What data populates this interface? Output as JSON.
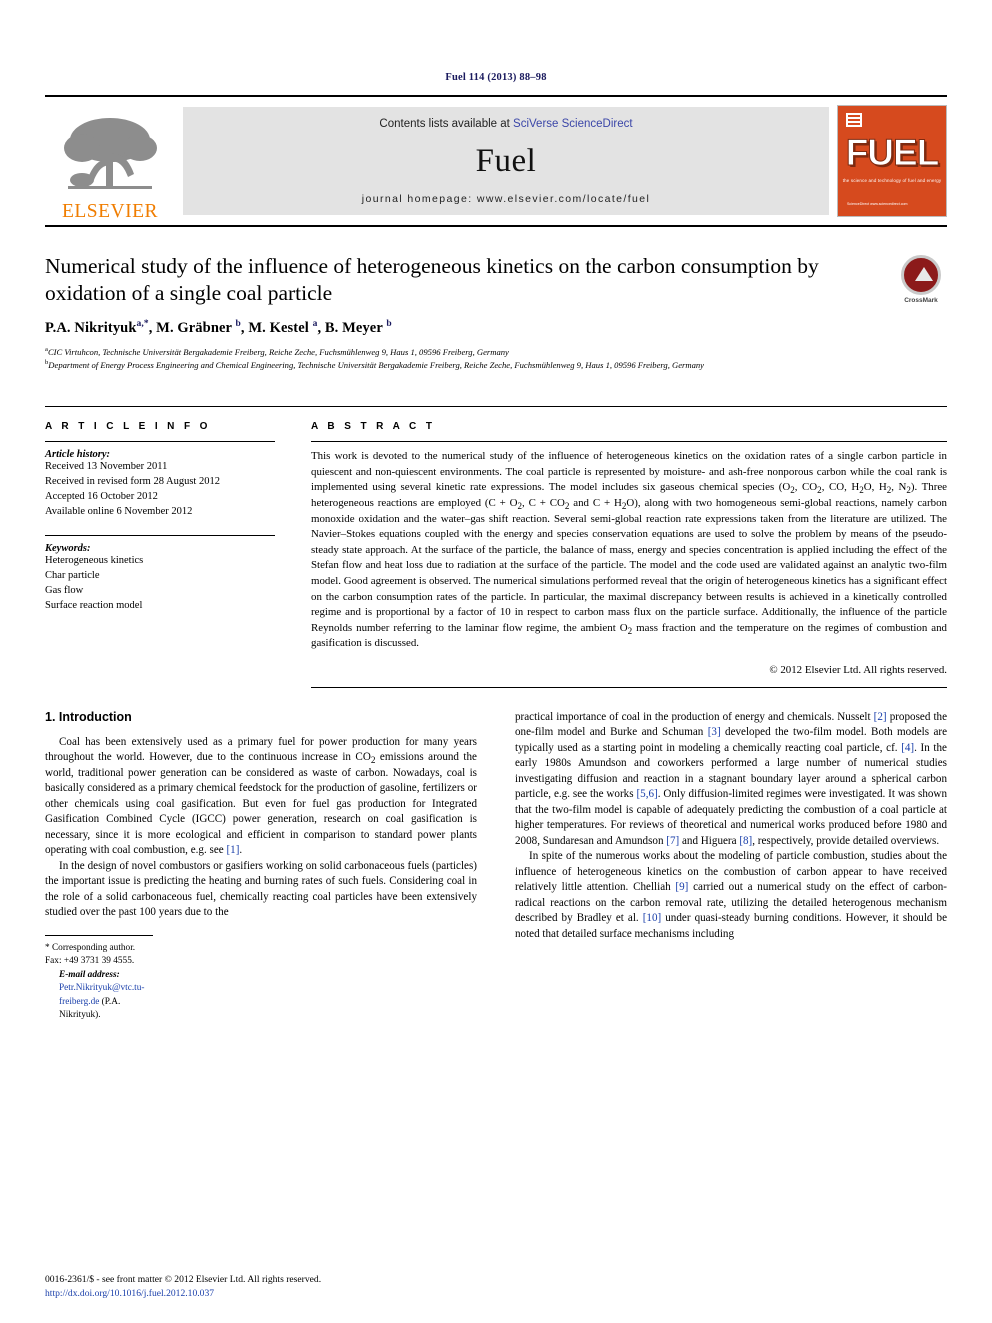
{
  "running_head": "Fuel 114 (2013) 88–98",
  "masthead": {
    "publisher_name": "ELSEVIER",
    "contents_prefix": "Contents lists available at ",
    "contents_link": "SciVerse ScienceDirect",
    "journal_title": "Fuel",
    "homepage": "journal homepage: www.elsevier.com/locate/fuel",
    "cover": {
      "title": "FUEL",
      "subtitle": "the science and technology of fuel and energy",
      "footer": "ScienceDirect\nwww.sciencedirect.com"
    }
  },
  "article": {
    "title": "Numerical study of the influence of heterogeneous kinetics on the carbon consumption by oxidation of a single coal particle",
    "authors_html": "P.A. Nikrityuk<sup>a,*</sup>, M. Gräbner <sup>b</sup>, M. Kestel <sup>a</sup>, B. Meyer <sup>b</sup>",
    "affiliations": [
      "<sup>a</sup>CIC Virtuhcon, Technische Universität Bergakademie Freiberg, Reiche Zeche, Fuchsmühlenweg 9, Haus 1, 09596 Freiberg, Germany",
      "<sup>b</sup>Department of Energy Process Engineering and Chemical Engineering, Technische Universität Bergakademie Freiberg, Reiche Zeche, Fuchsmühlenweg 9, Haus 1, 09596 Freiberg, Germany"
    ],
    "crossmark_label": "CrossMark"
  },
  "info": {
    "heading": "A R T I C L E    I N F O",
    "history_label": "Article history:",
    "history": [
      "Received 13 November 2011",
      "Received in revised form 28 August 2012",
      "Accepted 16 October 2012",
      "Available online 6 November 2012"
    ],
    "keywords_label": "Keywords:",
    "keywords": [
      "Heterogeneous kinetics",
      "Char particle",
      "Gas flow",
      "Surface reaction model"
    ]
  },
  "abstract": {
    "heading": "A B S T R A C T",
    "text_html": "This work is devoted to the numerical study of the influence of heterogeneous kinetics on the oxidation rates of a single carbon particle in quiescent and non-quiescent environments. The coal particle is represented by moisture- and ash-free nonporous carbon while the coal rank is implemented using several kinetic rate expressions. The model includes six gaseous chemical species (O<sub>2</sub>, CO<sub>2</sub>, CO, H<sub>2</sub>O, H<sub>2</sub>, N<sub>2</sub>). Three heterogeneous reactions are employed (C&nbsp;+&nbsp;O<sub>2</sub>, C&nbsp;+&nbsp;CO<sub>2</sub> and C&nbsp;+&nbsp;H<sub>2</sub>O), along with two homogeneous semi-global reactions, namely carbon monoxide oxidation and the water–gas shift reaction. Several semi-global reaction rate expressions taken from the literature are utilized. The Navier–Stokes equations coupled with the energy and species conservation equations are used to solve the problem by means of the pseudo-steady state approach. At the surface of the particle, the balance of mass, energy and species concentration is applied including the effect of the Stefan flow and heat loss due to radiation at the surface of the particle. The model and the code used are validated against an analytic two-film model. Good agreement is observed. The numerical simulations performed reveal that the origin of heterogeneous kinetics has a significant effect on the carbon consumption rates of the particle. In particular, the maximal discrepancy between results is achieved in a kinetically controlled regime and is proportional by a factor of 10 in respect to carbon mass flux on the particle surface. Additionally, the influence of the particle Reynolds number referring to the laminar flow regime, the ambient O<sub>2</sub> mass fraction and the temperature on the regimes of combustion and gasification is discussed.",
    "copyright": "© 2012 Elsevier Ltd. All rights reserved."
  },
  "body": {
    "section_heading": "1. Introduction",
    "left_paragraphs_html": [
      "Coal has been extensively used as a primary fuel for power production for many years throughout the world. However, due to the continuous increase in CO<sub>2</sub> emissions around the world, traditional power generation can be considered as waste of carbon. Nowadays, coal is basically considered as a primary chemical feedstock for the production of gasoline, fertilizers or other chemicals using coal gasification. But even for fuel gas production for Integrated Gasification Combined Cycle (IGCC) power generation, research on coal gasification is necessary, since it is more ecological and efficient in comparison to standard power plants operating with coal combustion, e.g. see <span class=\"ref\">[1]</span>.",
      "In the design of novel combustors or gasifiers working on solid carbonaceous fuels (particles) the important issue is predicting the heating and burning rates of such fuels. Considering coal in the role of a solid carbonaceous fuel, chemically reacting coal particles have been extensively studied over the past 100&nbsp;years due to the"
    ],
    "right_paragraphs_html": [
      "practical importance of coal in the production of energy and chemicals. Nusselt <span class=\"ref\">[2]</span> proposed the one-film model and Burke and Schuman <span class=\"ref\">[3]</span> developed the two-film model. Both models are typically used as a starting point in modeling a chemically reacting coal particle, cf. <span class=\"ref\">[4]</span>. In the early 1980s Amundson and coworkers performed a large number of numerical studies investigating diffusion and reaction in a stagnant boundary layer around a spherical carbon particle, e.g. see the works <span class=\"ref\">[5,6]</span>. Only diffusion-limited regimes were investigated. It was shown that the two-film model is capable of adequately predicting the combustion of a coal particle at higher temperatures. For reviews of theoretical and numerical works produced before 1980 and 2008, Sundaresan and Amundson <span class=\"ref\">[7]</span> and Higuera <span class=\"ref\">[8]</span>, respectively, provide detailed overviews.",
      "In spite of the numerous works about the modeling of particle combustion, studies about the influence of heterogeneous kinetics on the combustion of carbon appear to have received relatively little attention. Chelliah <span class=\"ref\">[9]</span> carried out a numerical study on the effect of carbon-radical reactions on the carbon removal rate, utilizing the detailed heterogenous mechanism described by Bradley et al. <span class=\"ref\">[10]</span> under quasi-steady burning conditions. However, it should be noted that detailed surface mechanisms including"
    ]
  },
  "footnote": {
    "corresponding_html": "* Corresponding author. Fax: +49 3731 39 4555.",
    "email_html": "<span class=\"fn-em\">E-mail address:</span> <span class=\"linkblue\">Petr.Nikrityuk@vtc.tu-freiberg.de</span> (P.A. Nikrityuk)."
  },
  "footer": {
    "issn_line_html": "0016-2361/$ - see front matter © 2012 Elsevier Ltd. All rights reserved.",
    "doi_html": "<span class=\"linkblue\">http://dx.doi.org/10.1016/j.fuel.2012.10.037</span>"
  }
}
